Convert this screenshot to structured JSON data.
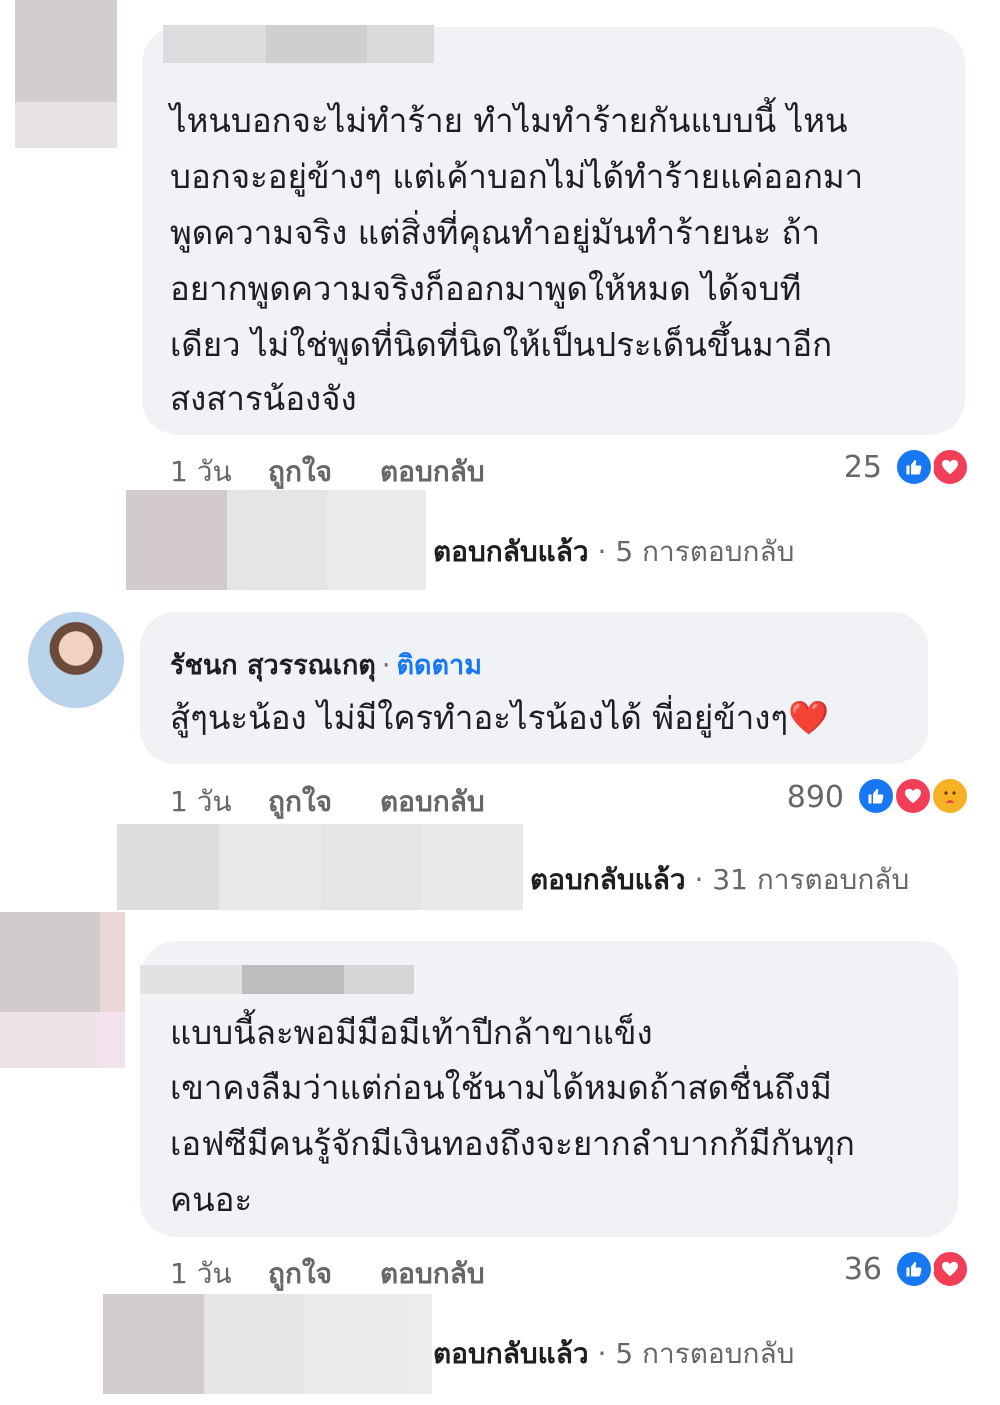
{
  "comments": [
    {
      "text_lines": [
        "ไหนบอกจะไม่ทำร้าย  ทำไมทำร้ายกันแบบนี้ ไหน",
        "บอกจะอยู่ข้างๆ แต่เค้าบอกไม่ได้ทำร้ายแค่ออกมา",
        "พูดความจริง แต่สิ่งที่คุณทำอยู่มันทำร้ายนะ ถ้า",
        "อยากพูดความจริงก็ออกมาพูดให้หมด ได้จบที",
        "เดียว   ไม่ใช่พูดที่นิดที่นิดให้เป็นประเด็นขึ้นมาอีก",
        "สงสารน้องจัง"
      ],
      "time": "1 วัน",
      "like_label": "ถูกใจ",
      "reply_label": "ตอบกลับ",
      "reaction_count": "25",
      "reactions": [
        "like-icon",
        "love-icon"
      ],
      "replies_by": "ตอบกลับแล้ว",
      "replies_count": "5 การตอบกลับ"
    },
    {
      "author": "รัชนก สุวรรณเกตุ",
      "follow_label": "ติดตาม",
      "text": "สู้ๆนะน้อง ไม่มีใครทำอะไรน้องได้ พี่อยู่ข้างๆ❤️",
      "time": "1 วัน",
      "like_label": "ถูกใจ",
      "reply_label": "ตอบกลับ",
      "reaction_count": "890",
      "reactions": [
        "like-icon",
        "love-icon",
        "care-icon"
      ],
      "replies_by": "ตอบกลับแล้ว",
      "replies_count": "31 การตอบกลับ"
    },
    {
      "text_lines": [
        "แบบนี้ละพอมีมือมีเท้าปีกล้าขาแข็ง",
        "เขาคงลืมว่าแต่ก่อนใช้นามได้หมดถ้าสดชื่นถึงมี",
        "เอฟซีมีคนรู้จักมีเงินทองถึงจะยากลำบากก้มีกันทุก",
        "คนอะ"
      ],
      "time": "1 วัน",
      "like_label": "ถูกใจ",
      "reply_label": "ตอบกลับ",
      "reaction_count": "36",
      "reactions": [
        "like-icon",
        "love-icon"
      ],
      "replies_by": "ตอบกลับแล้ว",
      "replies_count": "5 การตอบกลับ"
    }
  ],
  "colors": {
    "bubble": "#f0f2f5",
    "link": "#1877f2",
    "secondary_text": "#65676b",
    "like": "#1877f2",
    "love": "#f33e58",
    "care": "#f7b125"
  }
}
